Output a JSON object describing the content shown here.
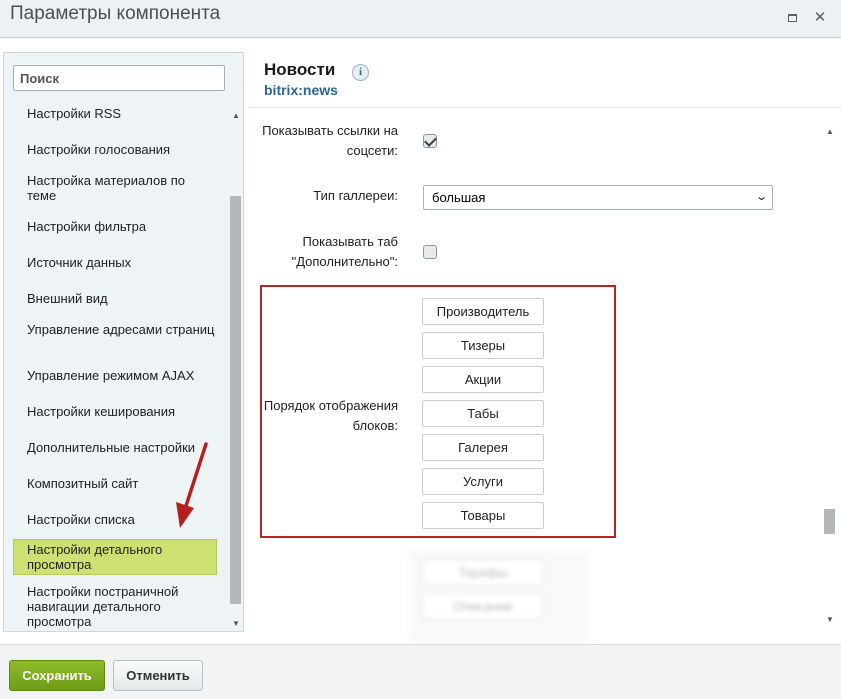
{
  "window": {
    "title": "Параметры компонента"
  },
  "sidebar": {
    "search_placeholder": "Поиск",
    "items": [
      {
        "label": "Настройки RSS"
      },
      {
        "label": "Настройки голосования"
      },
      {
        "label": "Настройка материалов по теме"
      },
      {
        "label": "Настройки фильтра"
      },
      {
        "label": "Источник данных"
      },
      {
        "label": "Внешний вид"
      },
      {
        "label": "Управление адресами страниц"
      },
      {
        "label": "Управление режимом AJAX"
      },
      {
        "label": "Настройки кеширования"
      },
      {
        "label": "Дополнительные настройки"
      },
      {
        "label": "Композитный сайт"
      },
      {
        "label": "Настройки списка"
      },
      {
        "label": "Настройки детального просмотра",
        "active": true
      },
      {
        "label": "Настройки постраничной навигации детального просмотра"
      }
    ]
  },
  "component": {
    "title": "Новости",
    "code": "bitrix:news",
    "info_icon": "info-icon"
  },
  "params": {
    "share_links_label": "Показывать ссылки на соцсети:",
    "share_links_checked": true,
    "gallery_type_label": "Тип галлереи:",
    "gallery_type_value": "большая",
    "extra_tab_label": "Показывать таб \"Дополнительно\":",
    "extra_tab_checked": false,
    "blocks_order_label": "Порядок отображения блоков:",
    "blocks": [
      "Производитель",
      "Тизеры",
      "Акции",
      "Табы",
      "Галерея",
      "Услуги",
      "Товары"
    ],
    "dragged_blocks": [
      "Тарифы",
      "Описание"
    ]
  },
  "footer": {
    "save_label": "Сохранить",
    "cancel_label": "Отменить"
  },
  "colors": {
    "accent_green": "#7aa81e",
    "active_item": "#cde072",
    "highlight_border": "#b52525",
    "link_blue": "#2a6496"
  }
}
